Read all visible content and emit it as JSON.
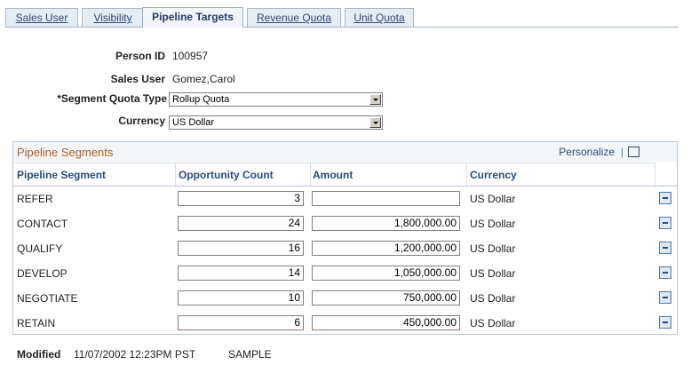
{
  "tabs": [
    {
      "label": "Sales User"
    },
    {
      "label": "Visibility"
    },
    {
      "label": "Pipeline Targets"
    },
    {
      "label": "Revenue Quota"
    },
    {
      "label": "Unit Quota"
    }
  ],
  "form": {
    "person_id_label": "Person ID",
    "person_id": "100957",
    "sales_user_label": "Sales User",
    "sales_user": "Gomez,Carol",
    "segment_quota_type_label": "*Segment Quota Type",
    "segment_quota_type": "Rollup Quota",
    "currency_label": "Currency",
    "currency": "US Dollar"
  },
  "grid": {
    "title": "Pipeline Segments",
    "personalize": "Personalize",
    "separator": "|",
    "columns": [
      "Pipeline Segment",
      "Opportunity Count",
      "Amount",
      "Currency"
    ],
    "rows": [
      {
        "segment": "REFER",
        "count": "3",
        "amount": "",
        "currency": "US Dollar"
      },
      {
        "segment": "CONTACT",
        "count": "24",
        "amount": "1,800,000.00",
        "currency": "US Dollar"
      },
      {
        "segment": "QUALIFY",
        "count": "16",
        "amount": "1,200,000.00",
        "currency": "US Dollar"
      },
      {
        "segment": "DEVELOP",
        "count": "14",
        "amount": "1,050,000.00",
        "currency": "US Dollar"
      },
      {
        "segment": "NEGOTIATE",
        "count": "10",
        "amount": "750,000.00",
        "currency": "US Dollar"
      },
      {
        "segment": "RETAIN",
        "count": "6",
        "amount": "450,000.00",
        "currency": "US Dollar"
      }
    ]
  },
  "footer": {
    "modified_label": "Modified",
    "modified_date": "11/07/2002 12:23PM PST",
    "modified_by": "SAMPLE"
  },
  "colors": {
    "accent": "#2a4a7a",
    "grid_title": "#b25d1e",
    "border": "#b8c6d6"
  },
  "icons": [
    "delete-row-icon",
    "dropdown-arrow-icon",
    "popout-grid-icon"
  ]
}
